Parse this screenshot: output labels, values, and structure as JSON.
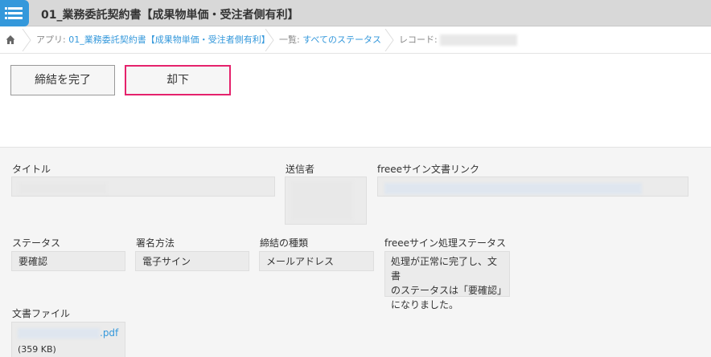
{
  "header": {
    "icon": "app-list-icon",
    "title": "01_業務委託契約書【成果物単価・受注者側有利】"
  },
  "breadcrumb": {
    "home_icon": "home-icon",
    "app_prefix": "アプリ: ",
    "app_name": "01_業務委託契約書【成果物単価・受注者側有利】",
    "list_prefix": "一覧: ",
    "list_name": "すべてのステータス",
    "record_prefix": "レコード: "
  },
  "actions": {
    "complete_label": "締結を完了",
    "reject_label": "却下"
  },
  "fields": {
    "title": {
      "label": "タイトル"
    },
    "sender": {
      "label": "送信者"
    },
    "doc_link": {
      "label": "freeeサイン文書リンク"
    },
    "status": {
      "label": "ステータス",
      "value": "要確認"
    },
    "sign_method": {
      "label": "署名方法",
      "value": "電子サイン"
    },
    "contract_type": {
      "label": "締結の種類",
      "value": "メールアドレス"
    },
    "process_status": {
      "label": "freeeサイン処理ステータス",
      "lines": [
        "処理が正常に完了し、文書",
        "のステータスは「要確認」",
        "になりました。"
      ]
    },
    "file": {
      "label": "文書ファイル",
      "ext": ".pdf",
      "size": "(359 KB)"
    }
  },
  "colors": {
    "accent": "#3498db",
    "danger_border": "#e5226c",
    "header_bg": "#d8d8d8"
  }
}
